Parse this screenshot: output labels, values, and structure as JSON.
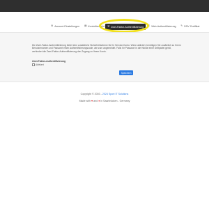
{
  "tabs": [
    {
      "label": "Account-Einstellungen",
      "icon": "gear-icon",
      "glyph": "⚙"
    },
    {
      "label": "Kontoübersicht",
      "icon": "list-icon",
      "glyph": "▤"
    },
    {
      "label": "Zwei-Faktor-Authentifizierung",
      "icon": "shield-icon",
      "glyph": "⛨",
      "active": true
    },
    {
      "label": "Web-Authentifizierung",
      "icon": "key-icon",
      "glyph": "⚿"
    },
    {
      "label": "DSV Zertifikat",
      "icon": "certificate-icon",
      "glyph": "✎"
    }
  ],
  "settings": {
    "description": "Die Zwei-Faktor-Authentifizierung bietet eine zusätzliche Sicherheitsebene für Ihr Service-Konto. Wenn aktiviert, benötigen Sie zusätzlich zu Ihrem Benutzernamen und Passwort einen Authentifizierungscode, wie zum angemeldet. Falls Ihr Passwort in die Hände einer Drittpartei gerät, verhindert die Zwei-Faktor-Authentifizierung den Zugang zu Ihrem Konto.",
    "option_label": "Zwei-Faktor-Authentifizierung",
    "checkbox_label": "Aktiviert",
    "save_label": "Speichern"
  },
  "footer": {
    "copyright_prefix": "Copyright © 2003 - ",
    "copyright_link": "2024 Sport IT Solutions",
    "made_with": "Made with",
    "and": "and",
    "location": "in Saarbrücken - Germany"
  },
  "colors": {
    "accent": "#2a7ae2",
    "highlight": "#f2e11b",
    "dark": "#2f2f2f"
  }
}
